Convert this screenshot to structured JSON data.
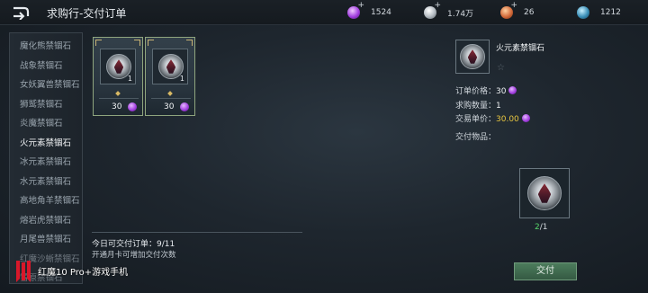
{
  "header": {
    "title": "求购行-交付订单",
    "back_icon": "back-arrow-icon"
  },
  "resources": [
    {
      "name": "purple-gem-icon",
      "value": "1524",
      "color": "#a340e0"
    },
    {
      "name": "silver-coin-icon",
      "value": "1.74万",
      "color": "#b9c0c6"
    },
    {
      "name": "copper-token-icon",
      "value": "26",
      "color": "#d36a3a"
    },
    {
      "name": "blue-orb-icon",
      "value": "1212",
      "color": "#3a8fb8"
    }
  ],
  "category_list": [
    "魔化熊禁锢石",
    "战象禁锢石",
    "女妖翼兽禁锢石",
    "狮鹫禁锢石",
    "炎魔禁锢石",
    "火元素禁锢石",
    "冰元素禁锢石",
    "水元素禁锢石",
    "高地角羊禁锢石",
    "熔岩虎禁锢石",
    "月尾兽禁锢石",
    "红魔沙蜥禁锢石",
    "雪原禁锢石"
  ],
  "active_category": "火元素禁锢石",
  "offers": [
    {
      "qty": "1",
      "price": "30"
    },
    {
      "qty": "1",
      "price": "30"
    }
  ],
  "bottom": {
    "orders_label": "今日可交付订单：",
    "orders_value": "9/11",
    "hint": "开通月卡可增加交付次数"
  },
  "detail": {
    "name": "火元素禁锢石",
    "price_label": "订单价格：",
    "price_value": "30",
    "quantity_label": "求购数量：",
    "quantity_value": "1",
    "unit_price_label": "交易单价：",
    "unit_price_value": "30.00",
    "deliver_items_label": "交付物品：",
    "deliver_have": "2",
    "deliver_need": "/1"
  },
  "deliver_button": "交付",
  "watermark": "红魔10 Pro+游戏手机"
}
